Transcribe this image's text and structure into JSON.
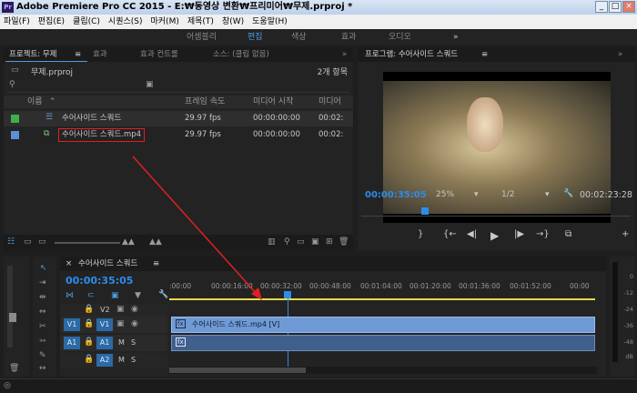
{
  "app": {
    "title": "Adobe Premiere Pro CC 2015 - E:₩동영상 변환₩프리미어₩무제.prproj *",
    "icon": "Pr"
  },
  "menu": [
    "파일(F)",
    "편집(E)",
    "클립(C)",
    "시퀀스(S)",
    "마커(M)",
    "제목(T)",
    "창(W)",
    "도움말(H)"
  ],
  "workspaces": [
    "어셈블리",
    "편집",
    "색상",
    "효과",
    "오디오"
  ],
  "project": {
    "tabs": [
      "프로젝트: 무제",
      "효과",
      "효과 컨트롤",
      "소스: (클립 없음)"
    ],
    "menu_glyph": "≡",
    "filename": "무제.prproj",
    "item_count": "2개 항목",
    "columns": {
      "name": "이름",
      "frame_rate": "프레임 속도",
      "media_start": "미디어 시작",
      "media_end": "미디어"
    },
    "rows": [
      {
        "name": "수어사이드 스쿼드",
        "fps": "29.97 fps",
        "start": "00:00:00:00",
        "end": "00:02:",
        "color": "#3db04a"
      },
      {
        "name": "수어사이드 스쿼드.mp4",
        "fps": "29.97 fps",
        "start": "00:00:00:00",
        "end": "00:02:",
        "color": "#5b8fd6"
      }
    ]
  },
  "program": {
    "tab": "프로그램: 수어사이드 스쿼드",
    "current_time": "00:00:35:05",
    "zoom": "25%",
    "quality": "1/2",
    "duration": "00:02:23:28"
  },
  "timeline": {
    "tab": "수어사이드 스쿼드",
    "current_time": "00:00:35:05",
    "ruler": [
      ":00:00",
      "00:00:16:00",
      "00:00:32:00",
      "00:00:48:00",
      "00:01:04:00",
      "00:01:20:00",
      "00:01:36:00",
      "00:01:52:00",
      "00:00"
    ],
    "tracks": [
      {
        "name": "V2"
      },
      {
        "name": "V1"
      },
      {
        "name": "A1"
      },
      {
        "name": "A2"
      }
    ],
    "clip_label": "수어사이드 스쿼드.mp4 [V]",
    "fx": "fx",
    "track_letters": {
      "m": "M",
      "s": "S"
    }
  },
  "meter": {
    "labels": [
      "0",
      "-12",
      "-24",
      "-36",
      "-48",
      "dB"
    ]
  },
  "colors": {
    "accent": "#2d8ceb",
    "highlight": "#e02020",
    "clip_video": "#6f9ad6",
    "clip_audio": "#3f5f8c"
  }
}
